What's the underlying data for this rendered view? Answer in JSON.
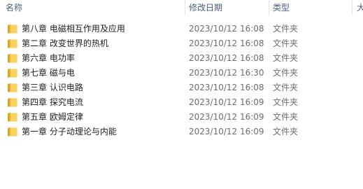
{
  "columns": {
    "name": "名称",
    "date": "修改日期",
    "type": "类型",
    "size": "大"
  },
  "rows": [
    {
      "name": "第八章   电磁相互作用及应用",
      "date": "2023/10/12 16:08",
      "type": "文件夹",
      "icon": "folder-icon"
    },
    {
      "name": "第二章 改变世界的热机",
      "date": "2023/10/12 16:08",
      "type": "文件夹",
      "icon": "folder-icon"
    },
    {
      "name": "第六章 电功率",
      "date": "2023/10/12 16:08",
      "type": "文件夹",
      "icon": "folder-icon"
    },
    {
      "name": "第七章   磁与电",
      "date": "2023/10/12 16:30",
      "type": "文件夹",
      "icon": "folder-icon"
    },
    {
      "name": "第三章 认识电路",
      "date": "2023/10/12 16:08",
      "type": "文件夹",
      "icon": "folder-icon"
    },
    {
      "name": "第四章   探究电流",
      "date": "2023/10/12 16:09",
      "type": "文件夹",
      "icon": "folder-icon"
    },
    {
      "name": "第五章   欧姆定律",
      "date": "2023/10/12 16:09",
      "type": "文件夹",
      "icon": "folder-icon"
    },
    {
      "name": "第一章   分子动理论与内能",
      "date": "2023/10/12 16:09",
      "type": "文件夹",
      "icon": "folder-icon"
    }
  ],
  "colors": {
    "header_text": "#4c607a",
    "folder_body": "#f4c552",
    "folder_back": "#d9a520",
    "secondary_text": "#6d6d6d"
  }
}
